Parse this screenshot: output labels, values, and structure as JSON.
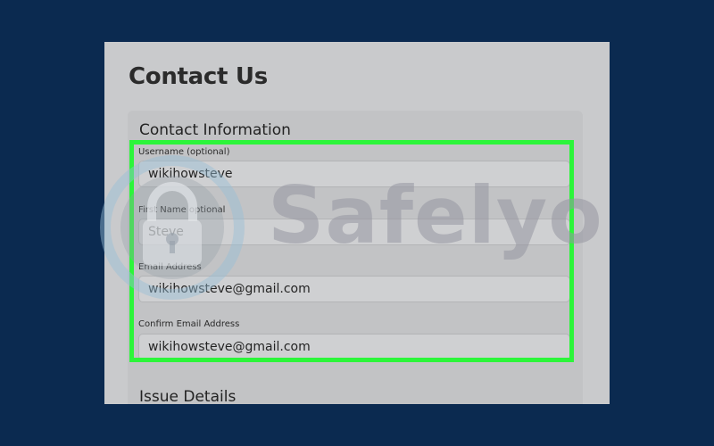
{
  "page": {
    "title": "Contact Us"
  },
  "contact_section": {
    "title": "Contact Information",
    "fields": [
      {
        "label": "Username (optional)",
        "value": "wikihowsteve"
      },
      {
        "label": "First Name optional",
        "value": "Steve"
      },
      {
        "label": "Email Address",
        "value": "wikihowsteve@gmail.com"
      },
      {
        "label": "Confirm Email Address",
        "value": "wikihowsteve@gmail.com"
      }
    ]
  },
  "issue_section": {
    "title": "Issue Details"
  },
  "watermark": {
    "text": "Safelyo",
    "icon": "lock-icon"
  },
  "colors": {
    "background": "#0b2a50",
    "panel": "#c9cacc",
    "highlight": "#2cf53a"
  }
}
